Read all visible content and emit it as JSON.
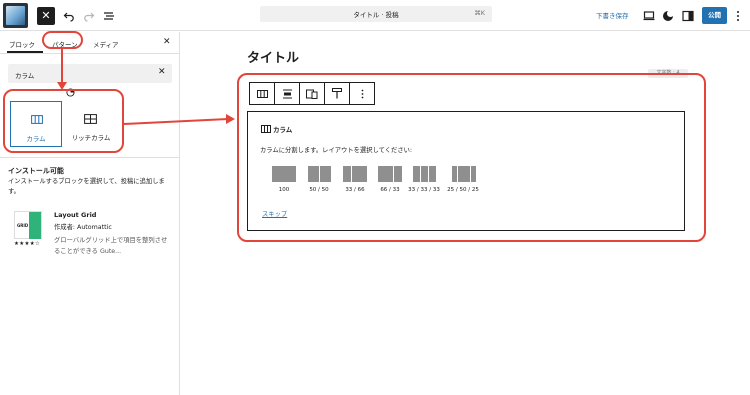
{
  "topbar": {
    "close_glyph": "✕",
    "command_search": "タイトル · 投稿",
    "command_shortcut": "⌘K",
    "save_draft": "下書き保存",
    "publish": "公開",
    "icons": [
      "site-logo",
      "close-icon",
      "undo-icon",
      "redo-icon",
      "list-view-icon",
      "preview-icon",
      "style-icon",
      "settings-icon"
    ]
  },
  "sidebar": {
    "tabs": [
      {
        "label": "ブロック"
      },
      {
        "label": "パターン"
      },
      {
        "label": "メディア"
      }
    ],
    "close_glyph": "✕",
    "search": {
      "value": "カラム",
      "clear_glyph": "✕"
    },
    "blocks": [
      {
        "label": "カラム",
        "icon": "columns-icon"
      },
      {
        "label": "リッチカラム",
        "icon": "rich-columns-icon"
      }
    ],
    "install": {
      "title": "インストール可能",
      "description": "インストールするブロックを選択して、投稿に追加します。"
    },
    "plugin": {
      "thumb_text": "GRID",
      "stars": "★★★★☆",
      "name": "Layout Grid",
      "author": "作成者: Automattic",
      "description": "グローバルグリッド上で項目を整列させることができる Gute..."
    }
  },
  "editor": {
    "title": "タイトル",
    "word_count": "文字数 : 4",
    "placeholder": {
      "title": "カラム",
      "instructions": "カラムに分割します。レイアウトを選択してください:",
      "variations": [
        {
          "label": "100"
        },
        {
          "label": "50 / 50"
        },
        {
          "label": "33 / 66"
        },
        {
          "label": "66 / 33"
        },
        {
          "label": "33 / 33 / 33"
        },
        {
          "label": "25 / 50 / 25"
        }
      ],
      "skip": "スキップ"
    }
  },
  "colors": {
    "accent": "#2271b1",
    "annotation": "#e2453a",
    "variation_fill": "#8f8f8f"
  }
}
